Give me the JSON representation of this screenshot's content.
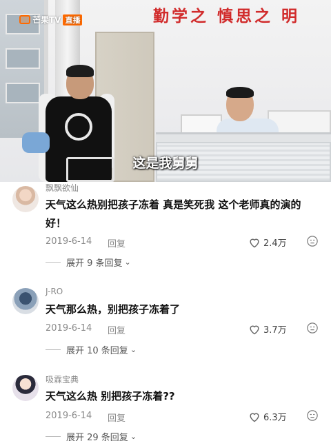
{
  "video": {
    "channel_logo": "芒果TV",
    "live_badge": "直播",
    "wall_slogan": "勤学之 慎思之 明",
    "subtitle": "这是我舅舅"
  },
  "comments": [
    {
      "username": "飘飘欲仙",
      "text_line1": "天气这么热别把孩子冻着 真是笑死我 这个老师真的演的",
      "text_line2": "好！",
      "date": "2019-6-14",
      "reply_label": "回复",
      "likes": "2.4万",
      "expand_label": "展开 9 条回复"
    },
    {
      "username": "J-RO",
      "text_line1": "天气那么热，别把孩子冻着了",
      "text_line2": "",
      "date": "2019-6-14",
      "reply_label": "回复",
      "likes": "3.7万",
      "expand_label": "展开 10 条回复"
    },
    {
      "username": "吸霖宝典",
      "text_line1": "天气这么热 别把孩子冻着??",
      "text_line2": "",
      "date": "2019-6-14",
      "reply_label": "回复",
      "likes": "6.3万",
      "expand_label": "展开 29 条回复"
    }
  ],
  "icons": {
    "like": "heart-icon",
    "dislike": "dislike-face-icon",
    "expand": "chevron-down-icon"
  },
  "colors": {
    "slogan_red": "#d12b2b",
    "logo_orange": "#ff6a00",
    "meta_gray": "#8a8a8a"
  }
}
